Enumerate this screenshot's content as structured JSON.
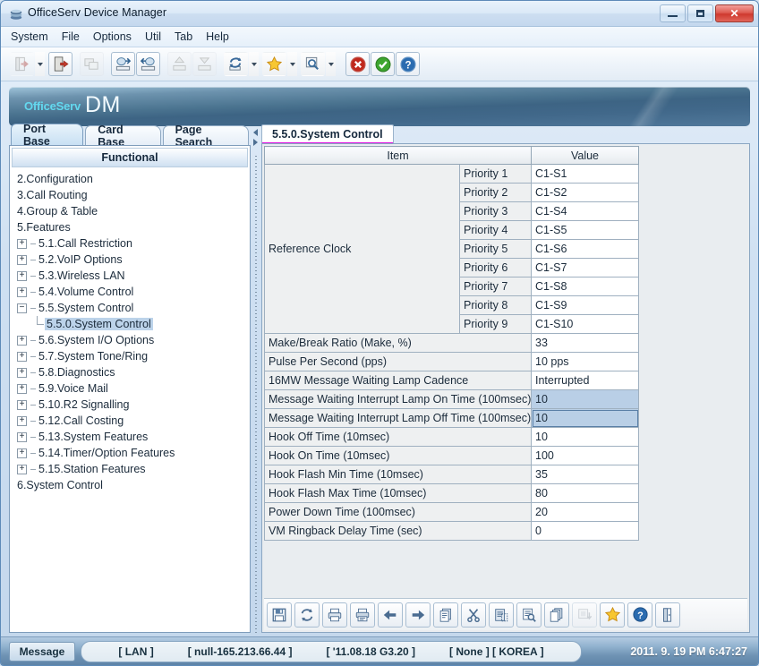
{
  "window": {
    "title": "OfficeServ Device Manager",
    "icon": "app-stack-icon",
    "buttons": {
      "minimize": "minimize",
      "maximize": "maximize",
      "close": "close"
    }
  },
  "menubar": {
    "items": [
      {
        "label": "System"
      },
      {
        "label": "File"
      },
      {
        "label": "Options"
      },
      {
        "label": "Util"
      },
      {
        "label": "Tab"
      },
      {
        "label": "Help"
      }
    ]
  },
  "toolbar": {
    "buttons": [
      {
        "name": "login-icon",
        "caret": true,
        "disabled": true
      },
      {
        "name": "logout-icon",
        "caret": false,
        "disabled": false,
        "framed": true
      },
      {
        "name": "device-icon",
        "caret": false,
        "disabled": true
      },
      {
        "name": "upload-db-icon",
        "caret": false,
        "disabled": false,
        "framed": true
      },
      {
        "name": "download-db-icon",
        "caret": false,
        "disabled": false,
        "framed": true
      },
      {
        "name": "package-up-icon",
        "caret": false,
        "disabled": true
      },
      {
        "name": "package-down-icon",
        "caret": false,
        "disabled": true
      },
      {
        "name": "refresh-icon",
        "caret": true,
        "disabled": false
      },
      {
        "name": "favorite-star-icon",
        "caret": true,
        "disabled": false
      },
      {
        "name": "search-icon",
        "caret": true,
        "disabled": false
      },
      {
        "name": "cancel-icon",
        "caret": false,
        "disabled": false,
        "framed": true
      },
      {
        "name": "confirm-icon",
        "caret": false,
        "disabled": false,
        "framed": true
      },
      {
        "name": "help-icon",
        "caret": false,
        "disabled": false,
        "framed": true
      }
    ]
  },
  "banner": {
    "brand": "OfficeServ",
    "product": "DM"
  },
  "sidebar": {
    "tabs": [
      {
        "label": "Port Base",
        "active": true
      },
      {
        "label": "Card Base",
        "active": false
      },
      {
        "label": "Page Search",
        "active": false
      }
    ],
    "header": "Functional",
    "tree": [
      {
        "label": "2.Configuration",
        "level": 0,
        "toggle": "none",
        "selected": false
      },
      {
        "label": "3.Call Routing",
        "level": 0,
        "toggle": "none",
        "selected": false
      },
      {
        "label": "4.Group & Table",
        "level": 0,
        "toggle": "none",
        "selected": false
      },
      {
        "label": "5.Features",
        "level": 0,
        "toggle": "none",
        "selected": false
      },
      {
        "label": "5.1.Call Restriction",
        "level": 1,
        "toggle": "plus",
        "selected": false
      },
      {
        "label": "5.2.VoIP Options",
        "level": 1,
        "toggle": "plus",
        "selected": false
      },
      {
        "label": "5.3.Wireless LAN",
        "level": 1,
        "toggle": "plus",
        "selected": false
      },
      {
        "label": "5.4.Volume Control",
        "level": 1,
        "toggle": "plus",
        "selected": false
      },
      {
        "label": "5.5.System Control",
        "level": 1,
        "toggle": "minus",
        "selected": false
      },
      {
        "label": "5.5.0.System Control",
        "level": 2,
        "toggle": "leaf",
        "selected": true
      },
      {
        "label": "5.6.System I/O Options",
        "level": 1,
        "toggle": "plus",
        "selected": false
      },
      {
        "label": "5.7.System Tone/Ring",
        "level": 1,
        "toggle": "plus",
        "selected": false
      },
      {
        "label": "5.8.Diagnostics",
        "level": 1,
        "toggle": "plus",
        "selected": false
      },
      {
        "label": "5.9.Voice Mail",
        "level": 1,
        "toggle": "plus",
        "selected": false
      },
      {
        "label": "5.10.R2 Signalling",
        "level": 1,
        "toggle": "plus",
        "selected": false
      },
      {
        "label": "5.12.Call Costing",
        "level": 1,
        "toggle": "plus",
        "selected": false
      },
      {
        "label": "5.13.System Features",
        "level": 1,
        "toggle": "plus",
        "selected": false
      },
      {
        "label": "5.14.Timer/Option Features",
        "level": 1,
        "toggle": "plus",
        "selected": false
      },
      {
        "label": "5.15.Station Features",
        "level": 1,
        "toggle": "plus",
        "selected": false
      },
      {
        "label": "6.System Control",
        "level": 0,
        "toggle": "none",
        "selected": false
      }
    ]
  },
  "content": {
    "tabs": [
      {
        "label": "5.5.0.System Control",
        "active": true
      }
    ],
    "table": {
      "headers": [
        "Item",
        "Value"
      ],
      "group": {
        "label": "Reference Clock",
        "rows": [
          {
            "sub": "Priority 1",
            "value": "C1-S1"
          },
          {
            "sub": "Priority 2",
            "value": "C1-S2"
          },
          {
            "sub": "Priority 3",
            "value": "C1-S4"
          },
          {
            "sub": "Priority 4",
            "value": "C1-S5"
          },
          {
            "sub": "Priority 5",
            "value": "C1-S6"
          },
          {
            "sub": "Priority 6",
            "value": "C1-S7"
          },
          {
            "sub": "Priority 7",
            "value": "C1-S8"
          },
          {
            "sub": "Priority 8",
            "value": "C1-S9"
          },
          {
            "sub": "Priority 9",
            "value": "C1-S10"
          }
        ]
      },
      "rows": [
        {
          "item": "Make/Break Ratio (Make, %)",
          "value": "33",
          "highlight": false,
          "focused": false
        },
        {
          "item": "Pulse Per Second (pps)",
          "value": "10 pps",
          "highlight": false,
          "focused": false
        },
        {
          "item": "16MW Message Waiting Lamp Cadence",
          "value": "Interrupted",
          "highlight": false,
          "focused": false
        },
        {
          "item": "Message Waiting Interrupt Lamp On Time (100msec)",
          "value": "10",
          "highlight": true,
          "focused": false
        },
        {
          "item": "Message Waiting Interrupt Lamp Off Time (100msec)",
          "value": "10",
          "highlight": true,
          "focused": true
        },
        {
          "item": "Hook Off Time (10msec)",
          "value": "10",
          "highlight": false,
          "focused": false
        },
        {
          "item": "Hook On Time (10msec)",
          "value": "100",
          "highlight": false,
          "focused": false
        },
        {
          "item": "Hook Flash Min Time (10msec)",
          "value": "35",
          "highlight": false,
          "focused": false
        },
        {
          "item": "Hook Flash Max Time (10msec)",
          "value": "80",
          "highlight": false,
          "focused": false
        },
        {
          "item": "Power Down Time (100msec)",
          "value": "20",
          "highlight": false,
          "focused": false
        },
        {
          "item": "VM Ringback Delay Time (sec)",
          "value": "0",
          "highlight": false,
          "focused": false
        }
      ]
    },
    "footer_buttons": [
      {
        "name": "save-icon",
        "disabled": false
      },
      {
        "name": "refresh-icon",
        "disabled": false
      },
      {
        "name": "print-icon",
        "disabled": false
      },
      {
        "name": "print-preview-icon",
        "disabled": false
      },
      {
        "name": "back-arrow-icon",
        "disabled": false
      },
      {
        "name": "forward-arrow-icon",
        "disabled": false
      },
      {
        "name": "copy-icon",
        "disabled": false
      },
      {
        "name": "cut-icon",
        "disabled": false
      },
      {
        "name": "paste-icon",
        "disabled": false
      },
      {
        "name": "find-icon",
        "disabled": false
      },
      {
        "name": "duplicate-icon",
        "disabled": false
      },
      {
        "name": "export-icon",
        "disabled": true
      },
      {
        "name": "favorite-star-icon",
        "disabled": false
      },
      {
        "name": "help-icon",
        "disabled": false
      },
      {
        "name": "exit-icon",
        "disabled": false
      }
    ]
  },
  "statusbar": {
    "message_label": "Message",
    "fields": [
      "[ LAN ]",
      "[ null-165.213.66.44 ]",
      "[ '11.08.18 G3.20 ]",
      "[ None ]  [ KOREA ]"
    ],
    "clock": "2011. 9. 19 PM 6:47:27"
  },
  "colors": {
    "accent_magenta": "#e014e0",
    "brand_cyan": "#63d8ef",
    "highlight_row": "#b9cfe6",
    "selection_blue": "#bcd3ea"
  }
}
